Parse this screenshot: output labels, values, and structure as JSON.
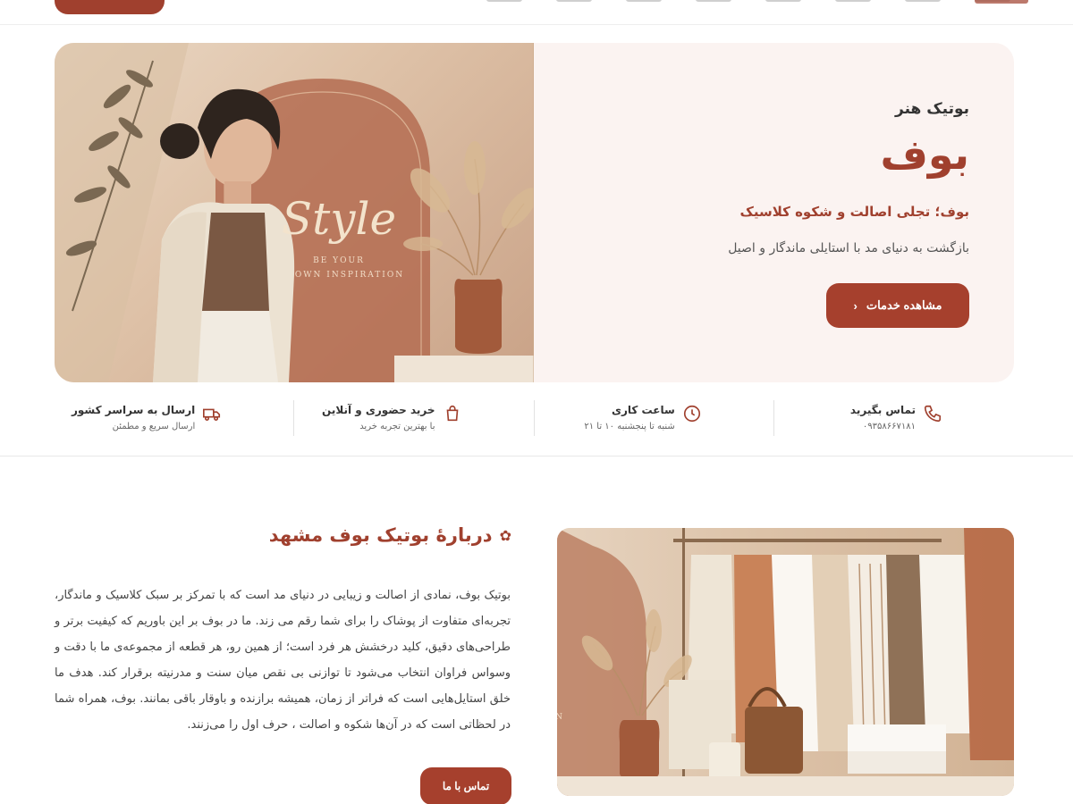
{
  "hero": {
    "kicker": "بوتیک هنر",
    "title": "بوف",
    "tagline": "بوف؛ تجلی اصالت و شکوه کلاسیک",
    "description": "بازگشت به دنیای مد با استایلی ماندگار و اصیل",
    "button_label": "مشاهده خدمات",
    "button_icon": "chevron-left-icon",
    "image_text": {
      "script": "Style",
      "line1": "BE YOUR",
      "line2": "OWN INSPIRATION"
    }
  },
  "info": [
    {
      "icon": "phone-icon",
      "title": "تماس بگیرید",
      "subtitle": "۰۹۳۵۸۶۶۷۱۸۱"
    },
    {
      "icon": "clock-icon",
      "title": "ساعت کاری",
      "subtitle": "شنبه تا پنجشنبه ۱۰ تا ۲۱"
    },
    {
      "icon": "shopping-bag-icon",
      "title": "خرید حضوری و آنلاین",
      "subtitle": "با بهترین تجربه خرید"
    },
    {
      "icon": "truck-icon",
      "title": "ارسال به سراسر کشور",
      "subtitle": "ارسال سریع و مطمئن"
    }
  ],
  "about": {
    "title": "دربارهٔ بوتیک بوف مشهد",
    "title_icon": "flower-icon",
    "paragraph": "بوتیک بوف، نمادی از اصالت و زیبایی در دنیای مد است که با تمرکز بر سبک کلاسیک و ماندگار، تجربه‌ای متفاوت از پوشاک را برای شما رقم می زند. ما در بوف بر این باوریم که کیفیت برتر و طراحی‌های دقیق، کلید درخشش هر فرد است؛ از همین رو، هر قطعه از مجموعه‌ی ما با دقت و وسواس فراوان انتخاب می‌شود تا توازنی بی نقص میان سنت و مدرنیته برقرار کند. هدف ما خلق استایل‌هایی است که فراتر از زمان، همیشه برازنده و باوقار باقی بمانند. بوف، همراه شما در لحظاتی است که در آن‌ها شکوه و اصالت ، حرف اول را می‌زنند.",
    "button_label": "تماس با ما",
    "image_text": "ON"
  },
  "colors": {
    "accent": "#a0402e",
    "hero_bg": "#fbf3f1"
  }
}
